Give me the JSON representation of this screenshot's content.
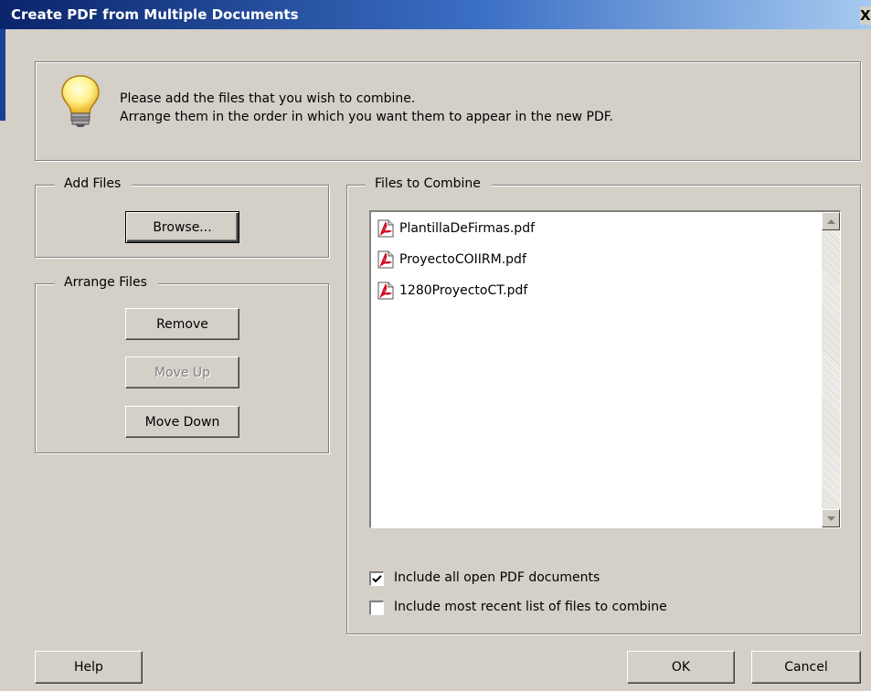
{
  "window": {
    "title": "Create PDF from Multiple Documents",
    "close_glyph": "X"
  },
  "info": {
    "icon": "lightbulb-icon",
    "line1": "Please add the files that you wish to combine.",
    "line2": "Arrange them in the order in which you want them to appear in the new PDF."
  },
  "add_files": {
    "label": "Add Files",
    "browse_button": "Browse..."
  },
  "arrange_files": {
    "label": "Arrange Files",
    "remove_button": "Remove",
    "move_up_button": "Move Up",
    "move_down_button": "Move Down"
  },
  "files_to_combine": {
    "label": "Files to Combine",
    "files": [
      {
        "name": "PlantillaDeFirmas.pdf",
        "icon": "pdf-file-icon"
      },
      {
        "name": "ProyectoCOIIRM.pdf",
        "icon": "pdf-file-icon"
      },
      {
        "name": "1280ProyectoCT.pdf",
        "icon": "pdf-file-icon"
      }
    ]
  },
  "options": {
    "include_open": {
      "label": "Include all open PDF documents",
      "checked": true
    },
    "include_recent": {
      "label": "Include most recent list of files to combine",
      "checked": false
    }
  },
  "footer": {
    "help_button": "Help",
    "ok_button": "OK",
    "cancel_button": "Cancel"
  }
}
